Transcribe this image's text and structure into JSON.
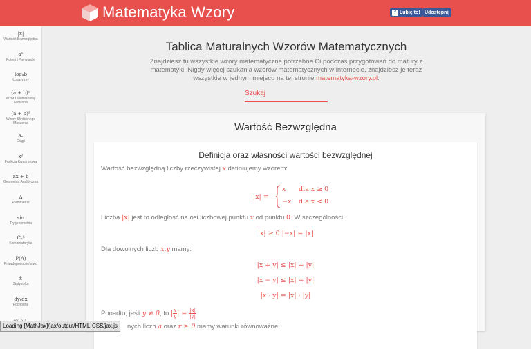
{
  "topbar": {
    "site_title": "Matematyka Wzory",
    "fb_like_label": "Lubię to!",
    "share_label": "Udostępnij",
    "accent_color": "#e8504d",
    "fb_color": "#3b5998"
  },
  "sidebar": {
    "items": [
      {
        "sym": "|x|",
        "label": "Wartość Bezwzględna"
      },
      {
        "sym": "aⁿ",
        "label": "Potęgi i Pierwiastki"
      },
      {
        "sym": "logₐb",
        "label": "Logarytmy"
      },
      {
        "sym": "(a + b)ⁿ",
        "label": "Wzór Dwumianowy Newtona"
      },
      {
        "sym": "(a + b)²",
        "label": "Wzory Skróconego Mnożenia"
      },
      {
        "sym": "aₙ",
        "label": "Ciągi"
      },
      {
        "sym": "x²",
        "label": "Funkcja Kwadratowa"
      },
      {
        "sym": "ax + b",
        "label": "Geometria Analityczna"
      },
      {
        "sym": "Δ",
        "label": "Planimetria"
      },
      {
        "sym": "sin",
        "label": "Trygonometria"
      },
      {
        "sym": "Cₙᵏ",
        "label": "Kombinatoryka"
      },
      {
        "sym": "P(A)",
        "label": "Prawdopodobieństwo"
      },
      {
        "sym": "x̄",
        "label": "Statystyka"
      },
      {
        "sym": "dy/dx",
        "label": "Pochodne"
      },
      {
        "sym": "∫f(x)dx",
        "label": ""
      }
    ]
  },
  "main": {
    "title": "Tablica Maturalnych Wzorów Matematycznych",
    "intro": "Znajdziesz tu wszystkie wzory matematyczne potrzebne Ci podczas przygotowań do matury z matematyki. Nigdy więcej szukania wzorów matematycznych w internecie, znajdziesz je teraz wszystkie w jednym miejscu na tej stronie",
    "intro_link": "matematyka-wzory.pl",
    "intro_end": ".",
    "search_placeholder": "Szukaj"
  },
  "card": {
    "title": "Wartość Bezwzględna",
    "subtitle": "Definicja oraz własności wartości bezwzględnej",
    "p1_a": "Wartość bezwzględną liczby rzeczywistej",
    "p1_var": "x",
    "p1_b": "definiujemy wzorem:",
    "def_lhs": "|x| =",
    "def_row1_val": "x",
    "def_row1_cond": "dla x ≥ 0",
    "def_row2_val": "−x",
    "def_row2_cond": "dla x < 0",
    "p2_a": "Liczba",
    "p2_var1": "|x|",
    "p2_b": "jest to odległość na osi liczbowej punktu",
    "p2_var2": "x",
    "p2_c": "od punktu",
    "p2_var3": "0",
    "p2_d": ". W szczególności:",
    "eq1": "|x| ≥ 0     |−x| = |x|",
    "p3_a": "Dla dowolnych liczb",
    "p3_var": "x,y",
    "p3_b": "mamy:",
    "eq2": "|x + y| ≤ |x| + |y|",
    "eq3": "|x − y| ≤ |x| + |y|",
    "eq4": "|x · y| = |x| · |y|",
    "p4_a": "Ponadto, jeśli",
    "p4_cond": "y ≠ 0",
    "p4_b": ", to",
    "p4_frac_num_l": "x",
    "p4_frac_den_l": "y",
    "p4_frac_num_r": "|x|",
    "p4_frac_den_r": "|y|",
    "p5_a": "nych liczb",
    "p5_var1": "a",
    "p5_b": "oraz",
    "p5_var2": "r ≥ 0",
    "p5_c": "mamy warunki równoważne:"
  },
  "status": {
    "loading": "Loading [MathJax]/jax/output/HTML-CSS/jax.js"
  }
}
